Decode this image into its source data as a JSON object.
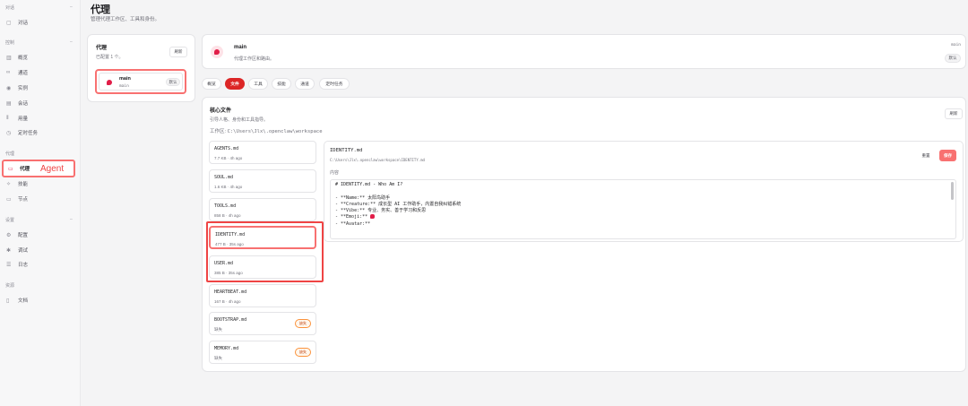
{
  "sidebar": {
    "sections": [
      {
        "title": "对话",
        "items": [
          {
            "label": "对话",
            "icon": "chat-icon"
          }
        ]
      },
      {
        "title": "控制",
        "items": [
          {
            "label": "概览",
            "icon": "chart-icon"
          },
          {
            "label": "通道",
            "icon": "link-icon"
          },
          {
            "label": "实例",
            "icon": "signal-icon"
          },
          {
            "label": "会话",
            "icon": "file-icon"
          },
          {
            "label": "用量",
            "icon": "bar-chart-icon"
          },
          {
            "label": "定时任务",
            "icon": "clock-icon"
          }
        ]
      },
      {
        "title": "代理",
        "items": [
          {
            "label": "代理",
            "icon": "folder-icon",
            "annotation": "Agent"
          },
          {
            "label": "技能",
            "icon": "sparkle-icon"
          },
          {
            "label": "节点",
            "icon": "monitor-icon"
          }
        ]
      },
      {
        "title": "设置",
        "items": [
          {
            "label": "配置",
            "icon": "gear-icon"
          },
          {
            "label": "调试",
            "icon": "bug-icon"
          },
          {
            "label": "日志",
            "icon": "log-icon"
          }
        ]
      },
      {
        "title": "资源",
        "items": [
          {
            "label": "文档",
            "icon": "book-icon"
          }
        ]
      }
    ]
  },
  "header": {
    "title": "代理",
    "subtitle": "管理代理工作区、工具和身份。"
  },
  "agents_panel": {
    "title": "代理",
    "count_text": "已配置 1 个。",
    "refresh_label": "刷新",
    "agents": [
      {
        "name": "main",
        "id": "main",
        "badge": "默认"
      }
    ]
  },
  "agent_header": {
    "name": "main",
    "description": "代理工作区和路由。",
    "id": "main",
    "badge": "默认"
  },
  "tabs": [
    "概览",
    "文件",
    "工具",
    "技能",
    "通道",
    "定时任务"
  ],
  "active_tab": "文件",
  "core_files": {
    "title": "核心文件",
    "subtitle": "引导人格、身份和工具指导。",
    "workspace_label": "工作区:",
    "workspace_path": "C:\\Users\\Jlx\\.openclaw\\workspace",
    "refresh_label": "刷新",
    "files": [
      {
        "name": "AGENTS.md",
        "meta": "7.7 KB · 4h ago"
      },
      {
        "name": "SOUL.md",
        "meta": "1.6 KB · 4h ago"
      },
      {
        "name": "TOOLS.md",
        "meta": "858 B · 4h ago"
      },
      {
        "name": "IDENTITY.md",
        "meta": "477 B · 35s ago"
      },
      {
        "name": "USER.md",
        "meta": "385 B · 35s ago"
      },
      {
        "name": "HEARTBEAT.md",
        "meta": "167 B · 4h ago"
      },
      {
        "name": "BOOTSTRAP.md",
        "meta": "缺失",
        "missing_badge": "缺失"
      },
      {
        "name": "MEMORY.md",
        "meta": "缺失",
        "missing_badge": "缺失"
      }
    ]
  },
  "editor": {
    "file_name": "IDENTITY.md",
    "file_path": "C:\\Users\\Jlx\\.openclaw\\workspace\\IDENTITY.md",
    "reset_label": "重置",
    "save_label": "保存",
    "content_label": "内容",
    "lines": [
      "# IDENTITY.md - Who Am I?",
      "",
      "- **Name:** 太阳鸟助手",
      "- **Creature:** 成长型 AI 工作助手，内置自我纠错系统",
      "- **Vibe:** 专业、务实、善于学习和反思",
      "- **Emoji:** ",
      "- **Avatar:**"
    ]
  },
  "colors": {
    "accent": "#dc2626",
    "highlight": "#ef4444"
  }
}
